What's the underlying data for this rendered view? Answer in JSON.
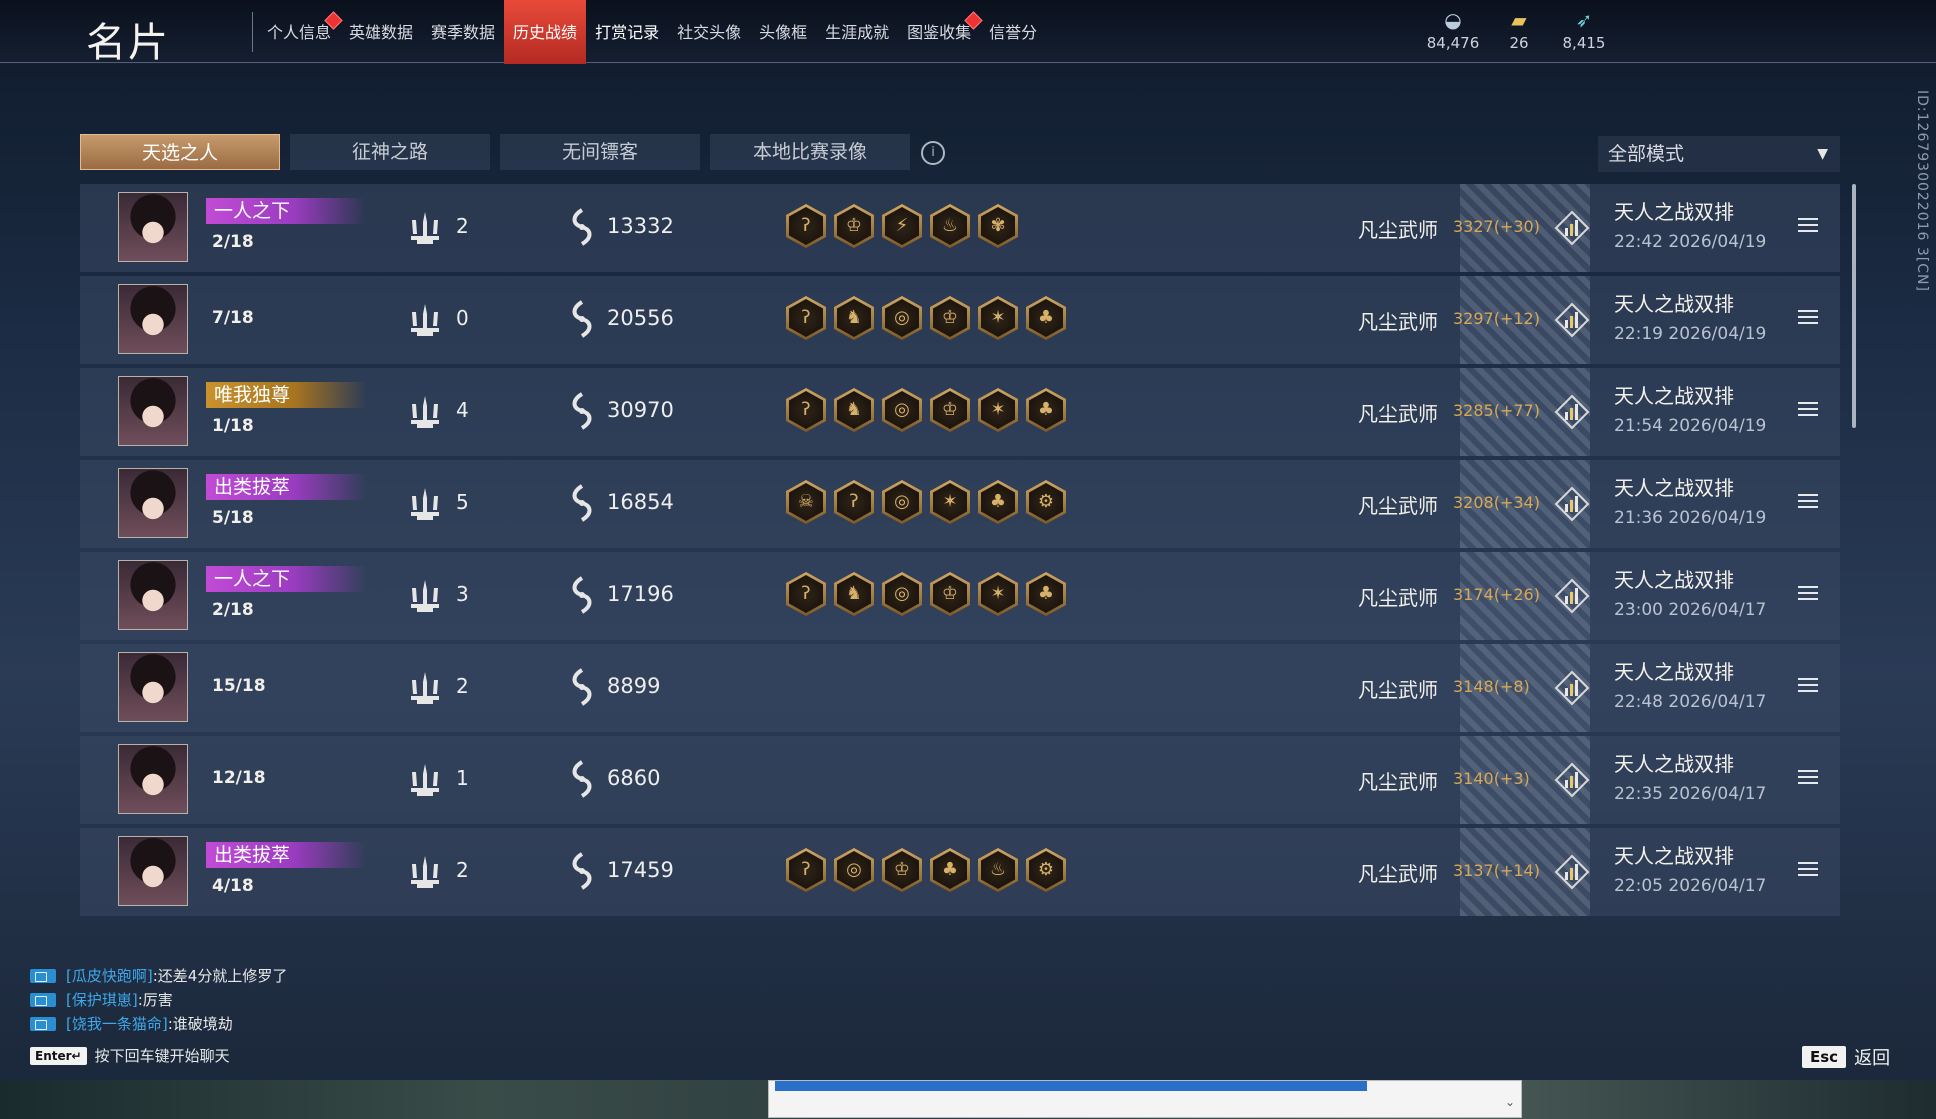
{
  "page_title": "名片",
  "nav_tabs": [
    {
      "label": "个人信息",
      "dot": true
    },
    {
      "label": "英雄数据",
      "dot": false
    },
    {
      "label": "赛季数据",
      "dot": false
    },
    {
      "label": "历史战绩",
      "dot": false,
      "active": true
    },
    {
      "label": "打赏记录",
      "dot": false
    },
    {
      "label": "社交头像",
      "dot": false
    },
    {
      "label": "头像框",
      "dot": false
    },
    {
      "label": "生涯成就",
      "dot": false
    },
    {
      "label": "图鉴收集",
      "dot": true
    },
    {
      "label": "信誉分",
      "dot": false
    }
  ],
  "resources": [
    {
      "icon": "silver-coin-icon",
      "value": "84,476"
    },
    {
      "icon": "gold-ingot-icon",
      "value": "26"
    },
    {
      "icon": "feather-currency-icon",
      "value": "8,415"
    }
  ],
  "side_id": "ID:1267930022016 3[CN]",
  "sub_tabs": [
    "天选之人",
    "征神之路",
    "无间镖客",
    "本地比赛录像"
  ],
  "mode_select": "全部模式",
  "rows": [
    {
      "title": "一人之下",
      "title_color": "purple",
      "rank": "2/18",
      "kills": "2",
      "damage": "13332",
      "badges": [
        "ʔ",
        "♔",
        "⚡",
        "♨",
        "✾"
      ],
      "rank_label": "凡尘武师",
      "score": "3327(+30)",
      "mode": "天人之战双排",
      "time": "22:42  2026/04/19"
    },
    {
      "title": "",
      "title_color": "",
      "rank": "7/18",
      "kills": "0",
      "damage": "20556",
      "badges": [
        "ʔ",
        "♞",
        "◎",
        "♔",
        "✶",
        "♣"
      ],
      "rank_label": "凡尘武师",
      "score": "3297(+12)",
      "mode": "天人之战双排",
      "time": "22:19  2026/04/19"
    },
    {
      "title": "唯我独尊",
      "title_color": "gold",
      "rank": "1/18",
      "kills": "4",
      "damage": "30970",
      "badges": [
        "ʔ",
        "♞",
        "◎",
        "♔",
        "✶",
        "♣"
      ],
      "rank_label": "凡尘武师",
      "score": "3285(+77)",
      "mode": "天人之战双排",
      "time": "21:54  2026/04/19"
    },
    {
      "title": "出类拔萃",
      "title_color": "purple",
      "rank": "5/18",
      "kills": "5",
      "damage": "16854",
      "badges": [
        "☠",
        "ʔ",
        "◎",
        "✶",
        "♣",
        "⚙"
      ],
      "rank_label": "凡尘武师",
      "score": "3208(+34)",
      "mode": "天人之战双排",
      "time": "21:36  2026/04/19"
    },
    {
      "title": "一人之下",
      "title_color": "purple",
      "rank": "2/18",
      "kills": "3",
      "damage": "17196",
      "badges": [
        "ʔ",
        "♞",
        "◎",
        "♔",
        "✶",
        "♣"
      ],
      "rank_label": "凡尘武师",
      "score": "3174(+26)",
      "mode": "天人之战双排",
      "time": "23:00  2026/04/17"
    },
    {
      "title": "",
      "title_color": "",
      "rank": "15/18",
      "kills": "2",
      "damage": "8899",
      "badges": [],
      "rank_label": "凡尘武师",
      "score": "3148(+8)",
      "mode": "天人之战双排",
      "time": "22:48  2026/04/17"
    },
    {
      "title": "",
      "title_color": "",
      "rank": "12/18",
      "kills": "1",
      "damage": "6860",
      "badges": [],
      "rank_label": "凡尘武师",
      "score": "3140(+3)",
      "mode": "天人之战双排",
      "time": "22:35  2026/04/17"
    },
    {
      "title": "出类拔萃",
      "title_color": "purple",
      "rank": "4/18",
      "kills": "2",
      "damage": "17459",
      "badges": [
        "ʔ",
        "◎",
        "♔",
        "♣",
        "♨",
        "⚙"
      ],
      "rank_label": "凡尘武师",
      "score": "3137(+14)",
      "mode": "天人之战双排",
      "time": "22:05  2026/04/17"
    }
  ],
  "chat": [
    {
      "user": "[瓜皮快跑啊]",
      "msg": ":还差4分就上修罗了"
    },
    {
      "user": "[保护琪崽]",
      "msg": ":厉害"
    },
    {
      "user": "[饶我一条猫命]",
      "msg": ":谁破境劫"
    }
  ],
  "enter_key": "Enter↵",
  "enter_hint": "按下回车键开始聊天",
  "esc_key": "Esc",
  "esc_label": "返回",
  "colors": {
    "active_tab": "#d23a2e",
    "subtab_active": "#b48256",
    "score": "#d8a855",
    "chat_user": "#3ea8ea"
  }
}
